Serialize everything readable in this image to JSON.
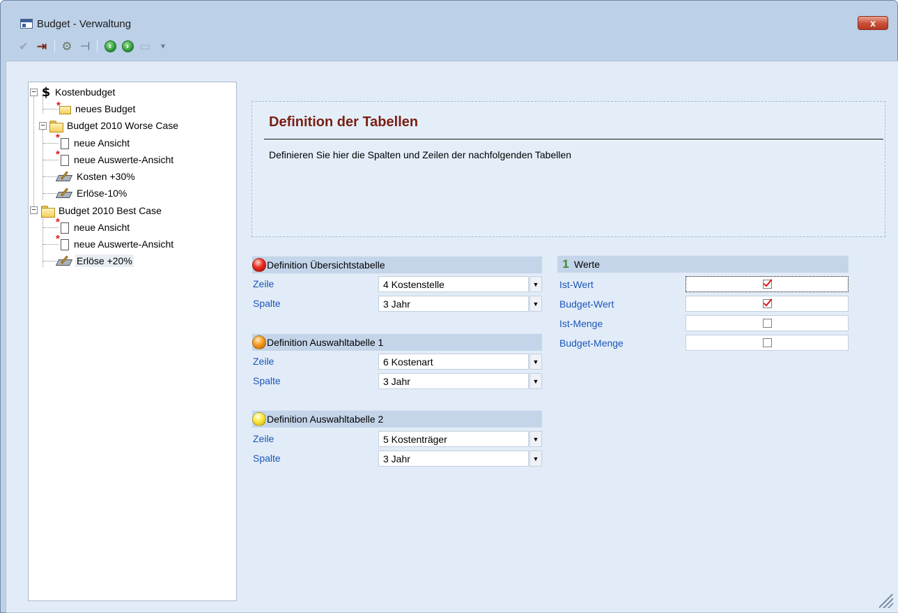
{
  "window": {
    "title": "Budget - Verwaltung",
    "close_label": "x"
  },
  "toolbar": {
    "buttons": [
      {
        "icon": "checkmark-icon",
        "glyph": "✔"
      },
      {
        "icon": "exit-icon",
        "glyph": "⇥"
      },
      {
        "icon": "tools-icon",
        "glyph": "⚙"
      },
      {
        "icon": "tree-insert-icon",
        "glyph": "⊣"
      },
      {
        "icon": "back-arrow-icon",
        "glyph": "‹"
      },
      {
        "icon": "forward-arrow-icon",
        "glyph": "›"
      },
      {
        "icon": "monitor-icon",
        "glyph": "▭"
      },
      {
        "icon": "dropdown-arrow-icon",
        "glyph": "▾"
      }
    ]
  },
  "tree": {
    "items": [
      {
        "label": "Kostenbudget",
        "icon": "dollar-icon"
      },
      {
        "label": "neues Budget",
        "icon": "new-budget-folder-icon"
      },
      {
        "label": "Budget 2010 Worse Case",
        "icon": "folder-icon"
      },
      {
        "label": "neue Ansicht",
        "icon": "new-view-document-icon"
      },
      {
        "label": "neue Auswerte-Ansicht",
        "icon": "new-view-document-icon"
      },
      {
        "label": "Kosten +30%",
        "icon": "calculator-icon"
      },
      {
        "label": "Erlöse-10%",
        "icon": "calculator-icon"
      },
      {
        "label": "Budget 2010 Best Case",
        "icon": "folder-icon"
      },
      {
        "label": "neue Ansicht",
        "icon": "new-view-document-icon"
      },
      {
        "label": "neue Auswerte-Ansicht",
        "icon": "new-view-document-icon"
      },
      {
        "label": "Erlöse +20%",
        "icon": "calculator-icon",
        "selected": true
      }
    ],
    "expander_symbol": "−"
  },
  "header": {
    "title": "Definition der Tabellen",
    "description": "Definieren Sie hier die Spalten und Zeilen der nachfolgenden Tabellen"
  },
  "definitions": [
    {
      "title": "Definition Übersichtstabelle",
      "indicator_color": "#ec2a1c",
      "rows": [
        {
          "label": "Zeile",
          "value": "4 Kostenstelle"
        },
        {
          "label": "Spalte",
          "value": "3 Jahr"
        }
      ]
    },
    {
      "title": "Definition Auswahltabelle 1",
      "indicator_color": "#f59b1b",
      "rows": [
        {
          "label": "Zeile",
          "value": "6 Kostenart"
        },
        {
          "label": "Spalte",
          "value": "3 Jahr"
        }
      ]
    },
    {
      "title": "Definition Auswahltabelle 2",
      "indicator_color": "#fce53a",
      "rows": [
        {
          "label": "Zeile",
          "value": "5 Kostenträger"
        },
        {
          "label": "Spalte",
          "value": "3 Jahr"
        }
      ]
    }
  ],
  "combo_arrow": "▼",
  "werte": {
    "title": "Werte",
    "icon_glyph": "1",
    "rows": [
      {
        "label": "Ist-Wert",
        "checked": true
      },
      {
        "label": "Budget-Wert",
        "checked": true
      },
      {
        "label": "Ist-Menge",
        "checked": false
      },
      {
        "label": "Budget-Menge",
        "checked": false
      }
    ]
  },
  "colors": {
    "accent_title": "#7a1e12",
    "field_label": "#1a55b8",
    "check_mark": "#d61a1a"
  }
}
